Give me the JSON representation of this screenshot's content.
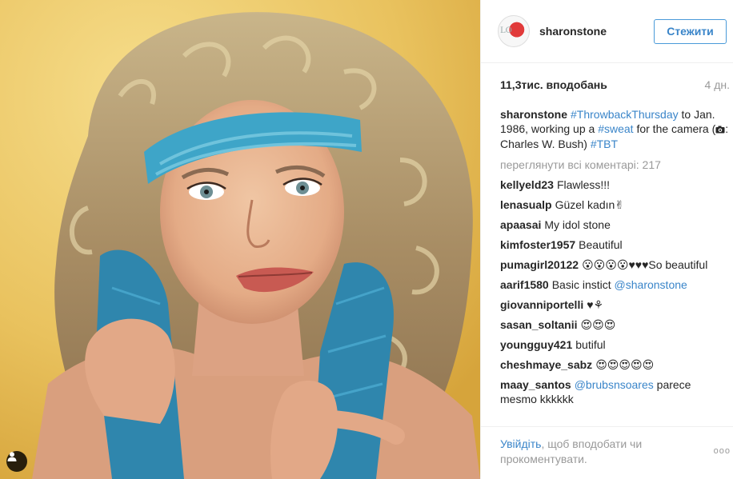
{
  "header": {
    "username": "sharonstone",
    "follow_label": "Стежити"
  },
  "post": {
    "likes": "11,3тис. вподобань",
    "time": "4 дн.",
    "caption": {
      "user": "sharonstone",
      "tag1": "#ThrowbackThursday",
      "text1": " to Jan. 1986, working up a ",
      "tag2": "#sweat",
      "text2": " for the camera (",
      "camera_icon": "camera-icon",
      "text3": ": Charles W. Bush) ",
      "tag3": "#TBT"
    },
    "view_all": "переглянути всі коментарі: 217"
  },
  "comments": [
    {
      "user": "kellyeld23",
      "text": "Flawless!!!"
    },
    {
      "user": "lenasualp",
      "text": "Güzel kadın✌"
    },
    {
      "user": "apaasai",
      "text": "My idol stone"
    },
    {
      "user": "kimfoster1957",
      "text": "Beautiful"
    },
    {
      "user": "pumagirl20122",
      "text": "😮😮😮😮♥♥♥So beautiful"
    },
    {
      "user": "aarif1580",
      "text": "Basic instict ",
      "mention": "@sharonstone"
    },
    {
      "user": "giovanniportelli",
      "text": "♥⚘"
    },
    {
      "user": "sasan_soltanii",
      "text": "😍😍😍"
    },
    {
      "user": "youngguy421",
      "text": "butiful"
    },
    {
      "user": "cheshmaye_sabz",
      "text": "😍😍😍😍😍"
    },
    {
      "user": "maay_santos",
      "mention": "@brubsnsoares",
      "text_after": " parece mesmo kkkkkk"
    }
  ],
  "footer": {
    "login_link": "Увійдіть",
    "text": ", щоб вподобати чи прокоментувати.",
    "more": "ooo"
  },
  "icons": {
    "user_tag": "user-tag-icon"
  },
  "colors": {
    "link": "#3a85c9",
    "muted": "#999999"
  }
}
